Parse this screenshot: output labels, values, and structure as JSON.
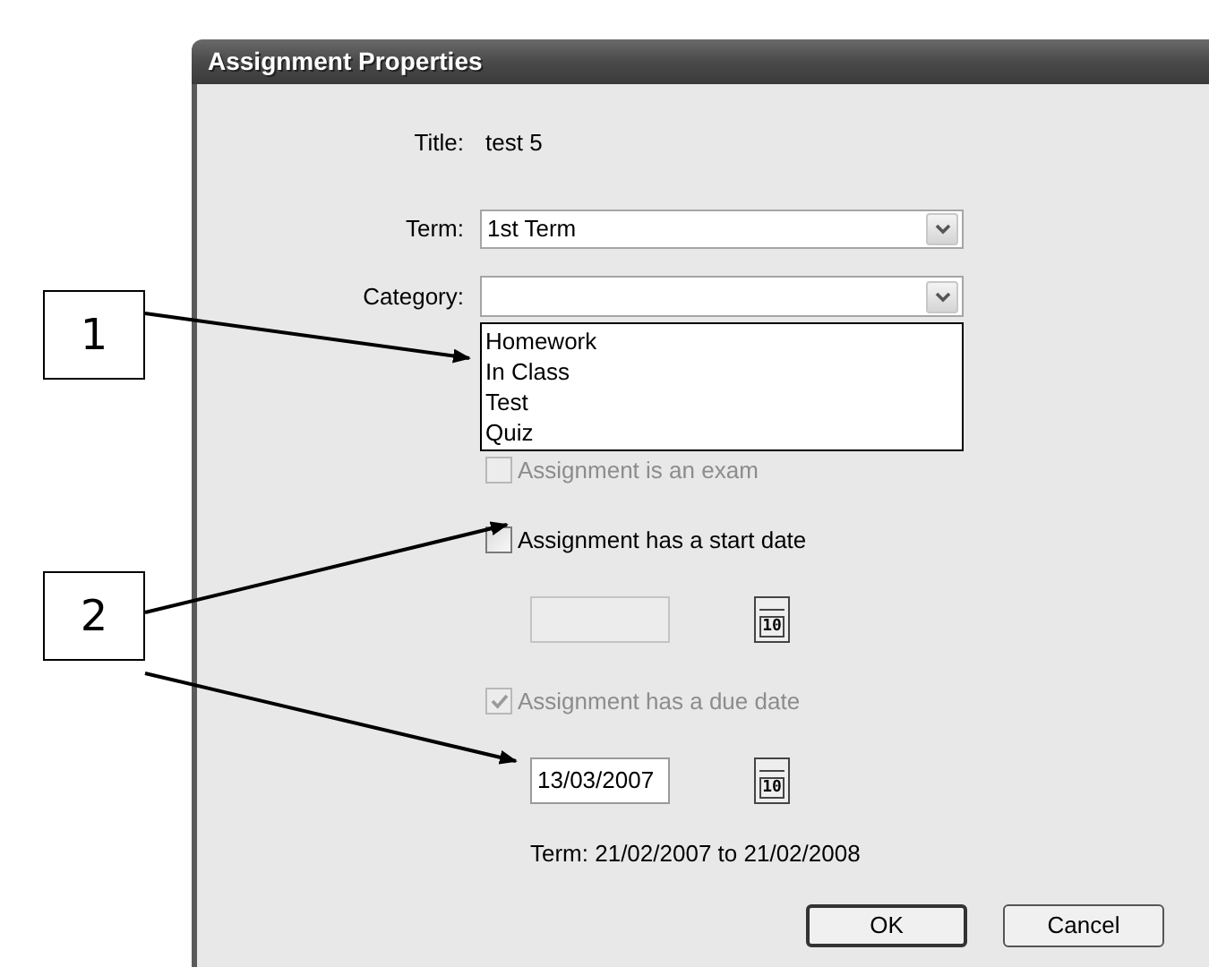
{
  "window": {
    "title": "Assignment Properties"
  },
  "title_row": {
    "label": "Title:",
    "value": "test 5"
  },
  "term": {
    "label": "Term:",
    "value": "1st Term"
  },
  "category": {
    "label": "Category:",
    "expanded": true,
    "options": [
      {
        "label": "Homework"
      },
      {
        "label": "In Class"
      },
      {
        "label": "Test"
      },
      {
        "label": "Quiz"
      }
    ]
  },
  "exam_checkbox": {
    "label": "Assignment is an exam",
    "checked": false,
    "disabled": true
  },
  "start_date": {
    "label": "Assignment has a start date",
    "checked": false,
    "disabled": false,
    "field_disabled": true,
    "calendar_glyph": "10"
  },
  "due_date": {
    "label": "Assignment has a due date",
    "checked": true,
    "disabled": true,
    "value": "13/03/2007",
    "field_disabled": false,
    "calendar_glyph": "10"
  },
  "term_range": "Term: 21/02/2007 to 21/02/2008",
  "buttons": [
    {
      "label": "OK",
      "default": true
    },
    {
      "label": "Cancel",
      "default": false
    }
  ],
  "callouts": [
    {
      "label": "1"
    },
    {
      "label": "2"
    }
  ]
}
